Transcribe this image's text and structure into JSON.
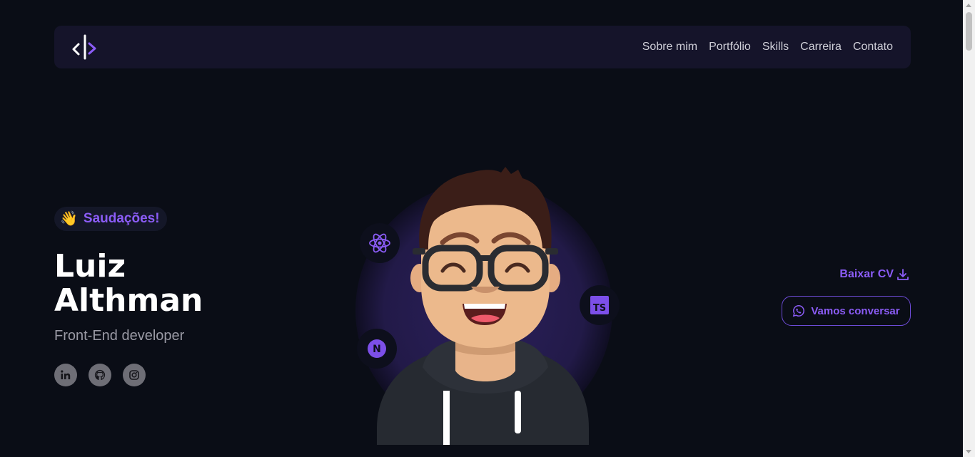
{
  "navbar": {
    "logo_icon": "code-bracket-logo",
    "links": [
      "Sobre mim",
      "Portfólio",
      "Skills",
      "Carreira",
      "Contato"
    ]
  },
  "hero": {
    "greeting_emoji": "👋",
    "greeting": "Saudações!",
    "first_name": "Luiz",
    "last_name": "Althman",
    "role": "Front-End developer",
    "socials": [
      "linkedin-icon",
      "github-icon",
      "instagram-icon"
    ]
  },
  "avatar": {
    "tech_icons": [
      "react-icon",
      "typescript-icon",
      "nextjs-icon"
    ],
    "ts_label": "TS",
    "next_label": "N"
  },
  "cta": {
    "cv_label": "Baixar CV",
    "chat_label": "Vamos conversar"
  },
  "colors": {
    "background": "#0a0d16",
    "navbar": "#15142a",
    "accent": "#8b5cf6"
  }
}
